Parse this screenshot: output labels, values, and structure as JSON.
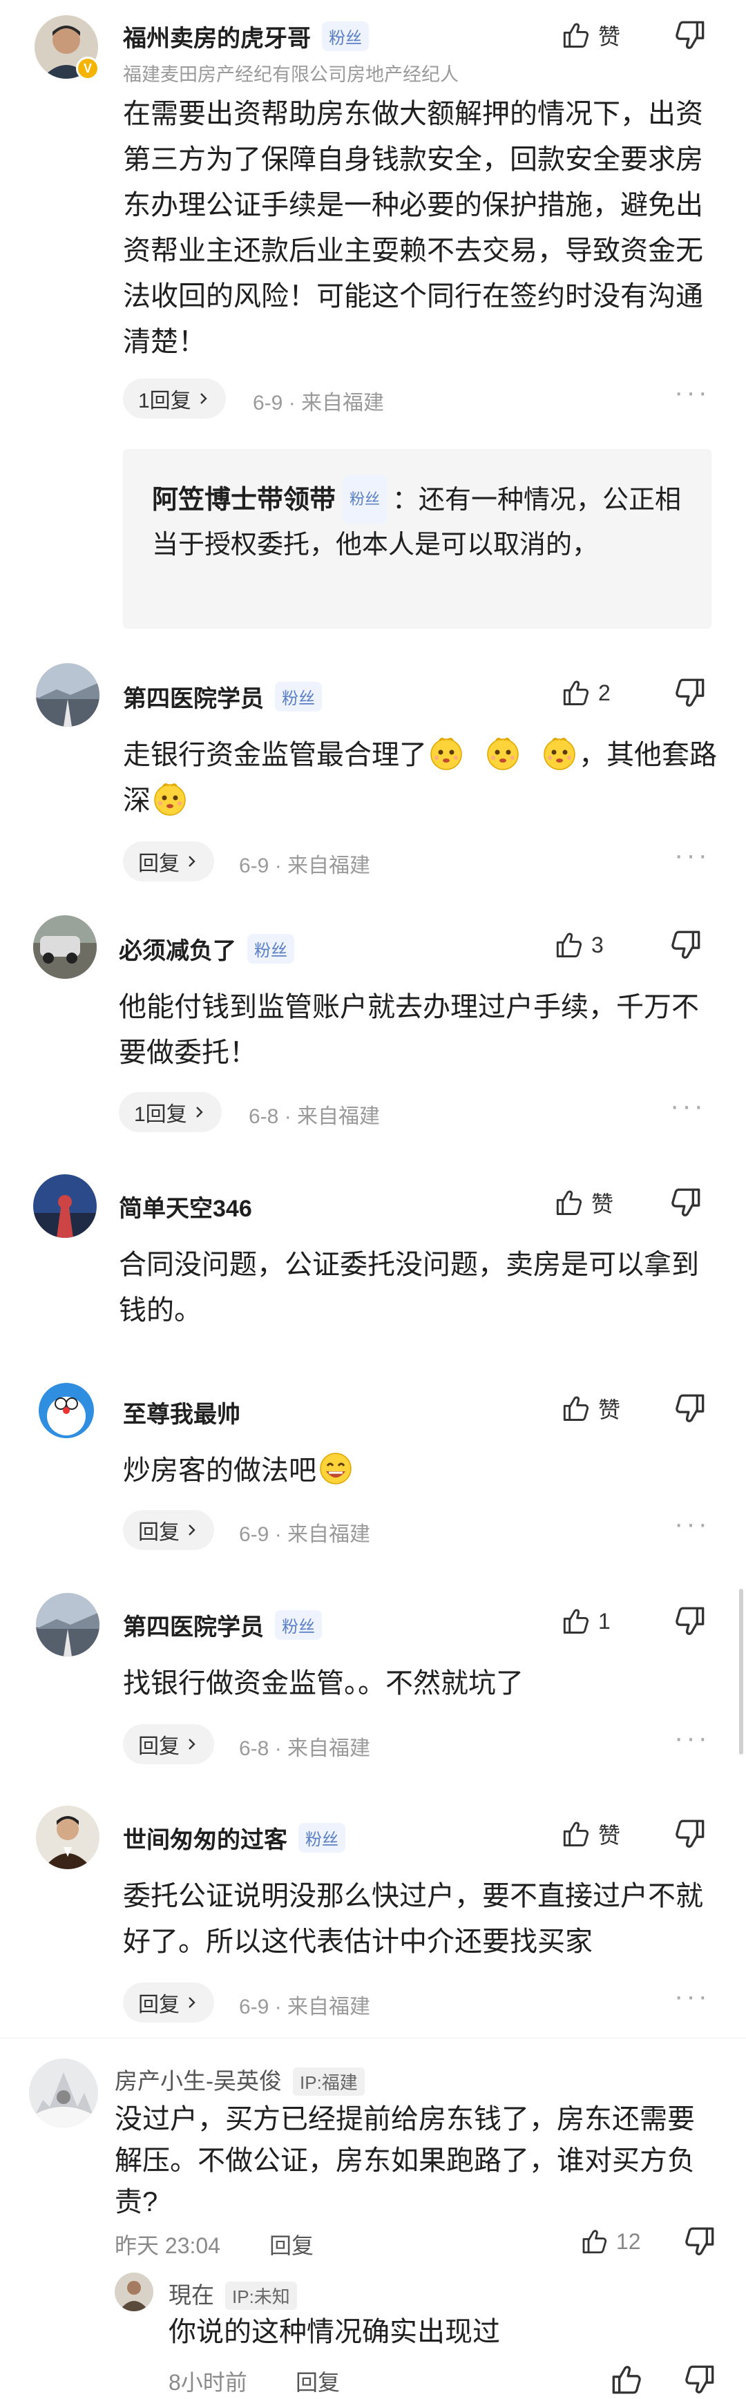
{
  "comments": [
    {
      "author": "福州卖房的虎牙哥",
      "fan": "粉丝",
      "subtitle": "福建麦田房产经纪有限公司房地产经纪人",
      "like": "赞",
      "text": "在需要出资帮助房东做大额解押的情况下，出资第三方为了保障自身钱款安全，回款安全要求房东办理公证手续是一种必要的保护措施，避免出资帮业主还款后业主耍赖不去交易，导致资金无法收回的风险！可能这个同行在签约时没有沟通清楚！",
      "reply_label": "1回复",
      "meta": "6-9 · 来自福建",
      "sub_reply": {
        "author": "阿笠博士带领带",
        "fan": "粉丝",
        "text": "：还有一种情况，公正相当于授权委托，他本人是可以取消的，"
      }
    },
    {
      "author": "第四医院学员",
      "fan": "粉丝",
      "like": "2",
      "text_a": "走银行资金监管最合理了",
      "text_b": "，其他套路深",
      "reply_label": "回复",
      "meta": "6-9 · 来自福建"
    },
    {
      "author": "必须减负了",
      "fan": "粉丝",
      "like": "3",
      "text": "他能付钱到监管账户就去办理过户手续，千万不要做委托！",
      "reply_label": "1回复",
      "meta": "6-8 · 来自福建"
    },
    {
      "author": "简单天空346",
      "like": "赞",
      "text": "合同没问题，公证委托没问题，卖房是可以拿到钱的。"
    },
    {
      "author": "至尊我最帅",
      "like": "赞",
      "text": "炒房客的做法吧",
      "reply_label": "回复",
      "meta": "6-9 · 来自福建"
    },
    {
      "author": "第四医院学员",
      "fan": "粉丝",
      "like": "1",
      "text": "找银行做资金监管。。不然就坑了",
      "reply_label": "回复",
      "meta": "6-8 · 来自福建"
    },
    {
      "author": "世间匆匆的过客",
      "fan": "粉丝",
      "like": "赞",
      "text": "委托公证说明没那么快过户，要不直接过户不就好了。所以这代表估计中介还要找买家",
      "reply_label": "回复",
      "meta": "6-9 · 来自福建"
    },
    {
      "author": "房产小生-吴英俊",
      "ip": "IP:福建",
      "text": "没过户，买方已经提前给房东钱了，房东还需要解压。不做公证，房东如果跑路了，谁对买方负责?",
      "time": "昨天 23:04",
      "reply_label": "回复",
      "like": "12"
    },
    {
      "author": "現在",
      "ip": "IP:未知",
      "text": "你说的这种情况确实出现过",
      "time": "8小时前",
      "reply_label": "回复"
    }
  ],
  "colors": {
    "fan_text": "#5a7fc4",
    "fan_bg": "#eef3fd",
    "meta": "#9a9a9a"
  },
  "icons": [
    "thumb-up-icon",
    "thumb-down-icon",
    "chevron-right-icon",
    "more-icon",
    "verified-badge-icon"
  ]
}
